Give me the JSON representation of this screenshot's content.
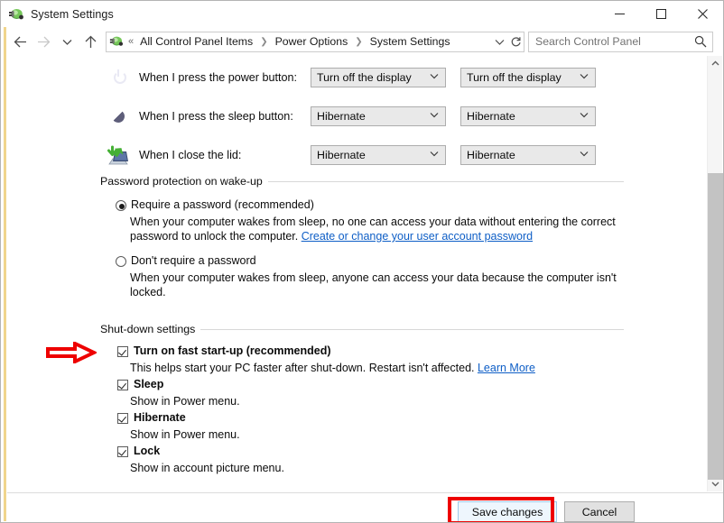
{
  "window": {
    "title": "System Settings",
    "title_icon": "power-plug-icon",
    "controls": {
      "minimize": "—",
      "maximize": "☐",
      "close": "✕"
    }
  },
  "navbar": {
    "back_icon": "back-arrow-icon",
    "forward_icon": "forward-arrow-icon",
    "recent_icon": "chevron-down-icon",
    "up_icon": "up-arrow-icon",
    "address_icon": "power-plug-icon",
    "breadcrumb_prefix": "«",
    "breadcrumbs": [
      "All Control Panel Items",
      "Power Options",
      "System Settings"
    ],
    "breadcrumb_separator": "❯",
    "dropdown_icon": "chevron-down-icon",
    "refresh_icon": "refresh-icon",
    "search": {
      "placeholder": "Search Control Panel",
      "value": "",
      "icon": "search-icon"
    }
  },
  "content": {
    "button_rows": [
      {
        "icon": "power-button-icon",
        "label": "When I press the power button:",
        "on_battery": "Turn off the display",
        "plugged_in": "Turn off the display"
      },
      {
        "icon": "sleep-button-icon",
        "label": "When I press the sleep button:",
        "on_battery": "Hibernate",
        "plugged_in": "Hibernate"
      },
      {
        "icon": "close-lid-icon",
        "label": "When I close the lid:",
        "on_battery": "Hibernate",
        "plugged_in": "Hibernate"
      }
    ],
    "password_group": {
      "header": "Password protection on wake-up",
      "options": [
        {
          "label": "Require a password (recommended)",
          "selected": true,
          "description_before": "When your computer wakes from sleep, no one can access your data without entering the correct password to unlock the computer. ",
          "link": "Create or change your user account password",
          "description_after": ""
        },
        {
          "label": "Don't require a password",
          "selected": false,
          "description_before": "When your computer wakes from sleep, anyone can access your data because the computer isn't locked.",
          "link": "",
          "description_after": ""
        }
      ]
    },
    "shutdown_group": {
      "header": "Shut-down settings",
      "items": [
        {
          "label": "Turn on fast start-up (recommended)",
          "checked": true,
          "description_before": "This helps start your PC faster after shut-down. Restart isn't affected. ",
          "link": "Learn More"
        },
        {
          "label": "Sleep",
          "checked": true,
          "description_before": "Show in Power menu.",
          "link": ""
        },
        {
          "label": "Hibernate",
          "checked": true,
          "description_before": "Show in Power menu.",
          "link": ""
        },
        {
          "label": "Lock",
          "checked": true,
          "description_before": "Show in account picture menu.",
          "link": ""
        }
      ]
    }
  },
  "scrollbar": {
    "up_icon": "chevron-up-icon",
    "down_icon": "chevron-down-icon"
  },
  "footer": {
    "save_label": "Save changes",
    "cancel_label": "Cancel"
  },
  "annotations": {
    "highlight_color": "#ee0000",
    "arrow_color": "#ee0000",
    "arrow_target": "turn-on-fast-startup-checkbox",
    "highlight_target": "save-changes-button"
  }
}
